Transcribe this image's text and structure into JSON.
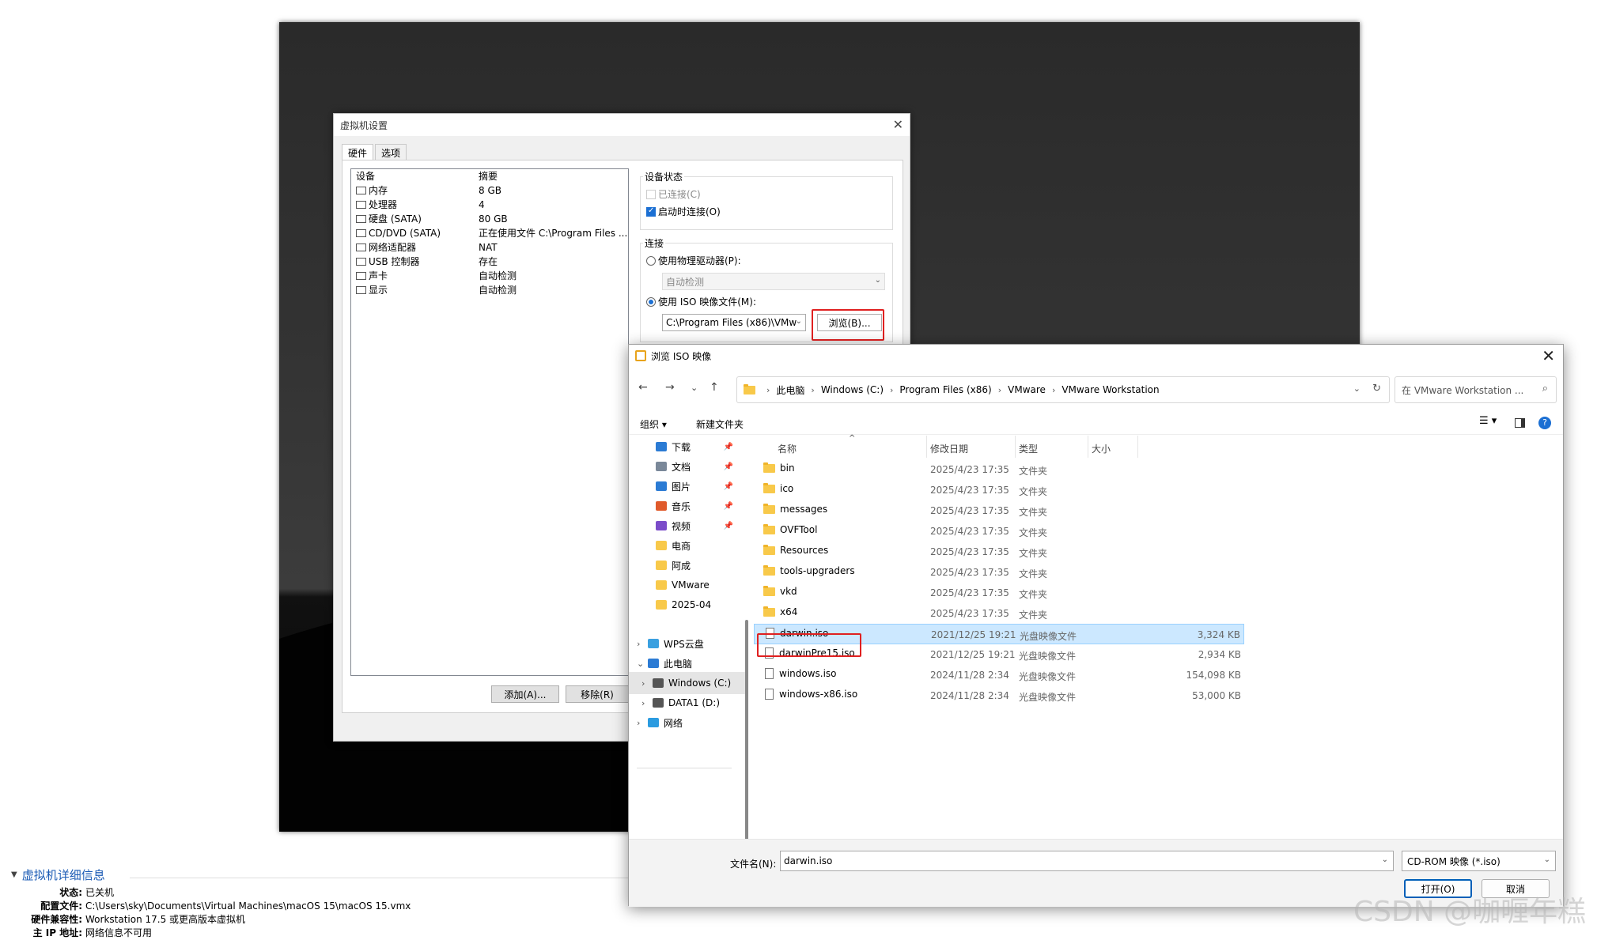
{
  "vm_details": {
    "title": "虚拟机详细信息",
    "rows": [
      {
        "k": "状态:",
        "v": "已关机"
      },
      {
        "k": "配置文件:",
        "v": "C:\\Users\\sky\\Documents\\Virtual Machines\\macOS 15\\macOS 15.vmx"
      },
      {
        "k": "硬件兼容性:",
        "v": "Workstation 17.5 或更高版本虚拟机"
      },
      {
        "k": "主 IP 地址:",
        "v": "网络信息不可用"
      }
    ]
  },
  "vm_settings": {
    "title": "虚拟机设置",
    "tabs": [
      "硬件",
      "选项"
    ],
    "list_headers": [
      "设备",
      "摘要"
    ],
    "devices": [
      {
        "name": "内存",
        "summary": "8 GB"
      },
      {
        "name": "处理器",
        "summary": "4"
      },
      {
        "name": "硬盘 (SATA)",
        "summary": "80 GB"
      },
      {
        "name": "CD/DVD (SATA)",
        "summary": "正在使用文件 C:\\Program Files ..."
      },
      {
        "name": "网络适配器",
        "summary": "NAT"
      },
      {
        "name": "USB 控制器",
        "summary": "存在"
      },
      {
        "name": "声卡",
        "summary": "自动检测"
      },
      {
        "name": "显示",
        "summary": "自动检测"
      }
    ],
    "add_button": "添加(A)...",
    "remove_button": "移除(R)",
    "device_status": {
      "title": "设备状态",
      "connected": "已连接(C)",
      "connect_on_power": "启动时连接(O)"
    },
    "connection": {
      "title": "连接",
      "physical": "使用物理驱动器(P):",
      "physical_value": "自动检测",
      "iso": "使用 ISO 映像文件(M):",
      "iso_value": "C:\\Program Files (x86)\\VMw",
      "browse": "浏览(B)..."
    }
  },
  "iso_dialog": {
    "title": "浏览 ISO 映像",
    "breadcrumbs": [
      "此电脑",
      "Windows (C:)",
      "Program Files (x86)",
      "VMware",
      "VMware Workstation"
    ],
    "search_placeholder": "在 VMware Workstation ...",
    "toolbar": {
      "organize": "组织 ▾",
      "new_folder": "新建文件夹"
    },
    "nav_items": [
      {
        "label": "下载",
        "pinned": true
      },
      {
        "label": "文档",
        "pinned": true
      },
      {
        "label": "图片",
        "pinned": true
      },
      {
        "label": "音乐",
        "pinned": true
      },
      {
        "label": "视频",
        "pinned": true
      },
      {
        "label": "电商",
        "pinned": false
      },
      {
        "label": "阿成",
        "pinned": false
      },
      {
        "label": "VMware",
        "pinned": false
      },
      {
        "label": "2025-04",
        "pinned": false
      },
      {
        "label": "WPS云盘",
        "pinned": false
      },
      {
        "label": "此电脑",
        "pinned": false
      },
      {
        "label": "Windows (C:)",
        "pinned": false
      },
      {
        "label": "DATA1 (D:)",
        "pinned": false
      },
      {
        "label": "网络",
        "pinned": false
      }
    ],
    "columns": [
      "名称",
      "修改日期",
      "类型",
      "大小"
    ],
    "files": [
      {
        "name": "bin",
        "date": "2025/4/23 17:35",
        "type": "文件夹",
        "size": "",
        "kind": "folder"
      },
      {
        "name": "ico",
        "date": "2025/4/23 17:35",
        "type": "文件夹",
        "size": "",
        "kind": "folder"
      },
      {
        "name": "messages",
        "date": "2025/4/23 17:35",
        "type": "文件夹",
        "size": "",
        "kind": "folder"
      },
      {
        "name": "OVFTool",
        "date": "2025/4/23 17:35",
        "type": "文件夹",
        "size": "",
        "kind": "folder"
      },
      {
        "name": "Resources",
        "date": "2025/4/23 17:35",
        "type": "文件夹",
        "size": "",
        "kind": "folder"
      },
      {
        "name": "tools-upgraders",
        "date": "2025/4/23 17:35",
        "type": "文件夹",
        "size": "",
        "kind": "folder"
      },
      {
        "name": "vkd",
        "date": "2025/4/23 17:35",
        "type": "文件夹",
        "size": "",
        "kind": "folder"
      },
      {
        "name": "x64",
        "date": "2025/4/23 17:35",
        "type": "文件夹",
        "size": "",
        "kind": "folder"
      },
      {
        "name": "darwin.iso",
        "date": "2021/12/25 19:21",
        "type": "光盘映像文件",
        "size": "3,324 KB",
        "kind": "file"
      },
      {
        "name": "darwinPre15.iso",
        "date": "2021/12/25 19:21",
        "type": "光盘映像文件",
        "size": "2,934 KB",
        "kind": "file"
      },
      {
        "name": "windows.iso",
        "date": "2024/11/28 2:34",
        "type": "光盘映像文件",
        "size": "154,098 KB",
        "kind": "file"
      },
      {
        "name": "windows-x86.iso",
        "date": "2024/11/28 2:34",
        "type": "光盘映像文件",
        "size": "53,000 KB",
        "kind": "file"
      }
    ],
    "selected_file": "darwin.iso",
    "filename_label": "文件名(N):",
    "filename_value": "darwin.iso",
    "filetype_value": "CD-ROM 映像 (*.iso)",
    "open_button": "打开(O)",
    "cancel_button": "取消"
  },
  "watermark": "CSDN @咖喱年糕"
}
